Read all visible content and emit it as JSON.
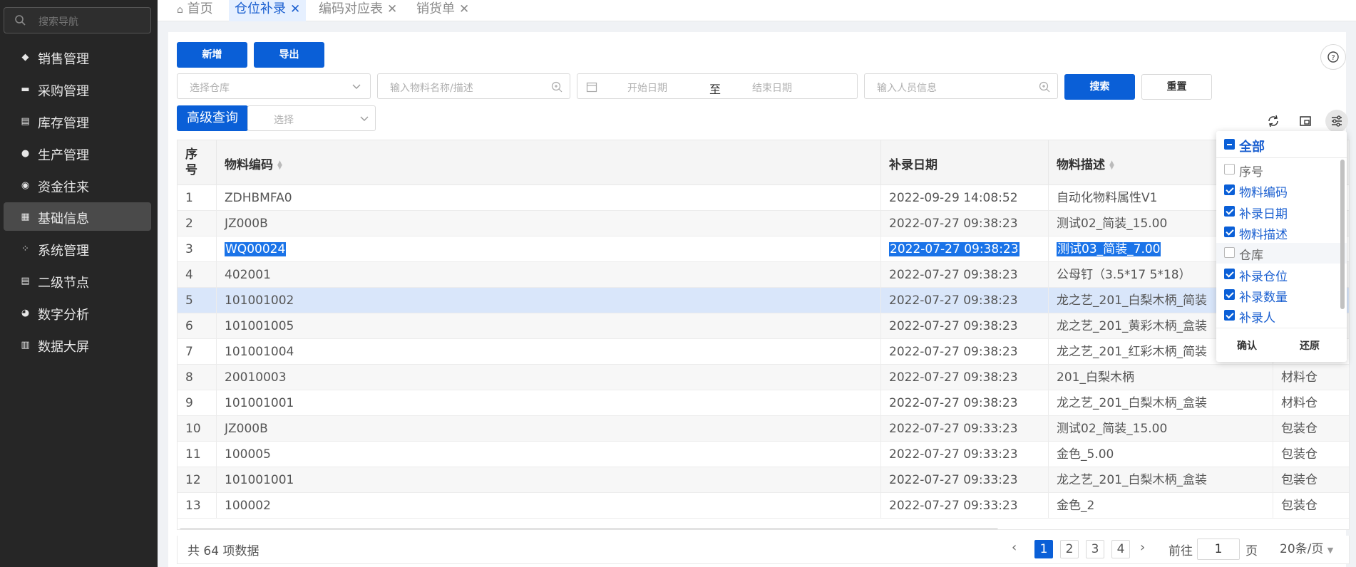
{
  "sidebar": {
    "search_placeholder": "搜索导航",
    "items": [
      {
        "label": "销售管理",
        "icon": "tag-icon"
      },
      {
        "label": "采购管理",
        "icon": "cart-icon"
      },
      {
        "label": "库存管理",
        "icon": "store-icon"
      },
      {
        "label": "生产管理",
        "icon": "cluster-icon"
      },
      {
        "label": "资金往来",
        "icon": "money-icon"
      },
      {
        "label": "基础信息",
        "icon": "grid-icon",
        "active": true
      },
      {
        "label": "系统管理",
        "icon": "apps-icon"
      },
      {
        "label": "二级节点",
        "icon": "list-icon"
      },
      {
        "label": "数字分析",
        "icon": "pie-icon"
      },
      {
        "label": "数据大屏",
        "icon": "report-icon"
      }
    ]
  },
  "tabs": [
    {
      "label": "首页"
    },
    {
      "label": "仓位补录"
    },
    {
      "label": "编码对应表"
    },
    {
      "label": "销货单"
    }
  ],
  "toolbar": {
    "add_label": "新增",
    "export_label": "导出"
  },
  "filters": {
    "warehouse_placeholder": "选择仓库",
    "material_placeholder": "输入物料名称/描述",
    "start_date_placeholder": "开始日期",
    "date_separator": "至",
    "end_date_placeholder": "结束日期",
    "person_placeholder": "输入人员信息",
    "search_label": "搜索",
    "reset_label": "重置",
    "advanced_label": "高级查询",
    "advanced_select_placeholder": "选择"
  },
  "table": {
    "headers": {
      "index": "序号",
      "material_code": "物料编码",
      "date": "补录日期",
      "description": "物料描述"
    },
    "rows": [
      {
        "index": "1",
        "code": "ZDHBMFA0",
        "date": "2022-09-29 14:08:52",
        "desc": "自动化物料属性V1",
        "wh": ""
      },
      {
        "index": "2",
        "code": "JZ000B",
        "date": "2022-07-27 09:38:23",
        "desc": "测试02_简装_15.00",
        "wh": ""
      },
      {
        "index": "3",
        "code": "WQ00024",
        "date": "2022-07-27 09:38:23",
        "desc": "测试03_简装_7.00",
        "wh": ""
      },
      {
        "index": "4",
        "code": "402001",
        "date": "2022-07-27 09:38:23",
        "desc": "公母钉（3.5*17 5*18）",
        "wh": ""
      },
      {
        "index": "5",
        "code": "101001002",
        "date": "2022-07-27 09:38:23",
        "desc": "龙之艺_201_白梨木柄_简装",
        "wh": ""
      },
      {
        "index": "6",
        "code": "101001005",
        "date": "2022-07-27 09:38:23",
        "desc": "龙之艺_201_黄彩木柄_盒装",
        "wh": ""
      },
      {
        "index": "7",
        "code": "101001004",
        "date": "2022-07-27 09:38:23",
        "desc": "龙之艺_201_红彩木柄_简装",
        "wh": ""
      },
      {
        "index": "8",
        "code": "20010003",
        "date": "2022-07-27 09:38:23",
        "desc": "201_白梨木柄",
        "wh": "材料仓"
      },
      {
        "index": "9",
        "code": "101001001",
        "date": "2022-07-27 09:38:23",
        "desc": "龙之艺_201_白梨木柄_盒装",
        "wh": "材料仓"
      },
      {
        "index": "10",
        "code": "JZ000B",
        "date": "2022-07-27 09:33:23",
        "desc": "测试02_简装_15.00",
        "wh": "包装仓"
      },
      {
        "index": "11",
        "code": "100005",
        "date": "2022-07-27 09:33:23",
        "desc": "金色_5.00",
        "wh": "包装仓"
      },
      {
        "index": "12",
        "code": "101001001",
        "date": "2022-07-27 09:33:23",
        "desc": "龙之艺_201_白梨木柄_盒装",
        "wh": "包装仓"
      },
      {
        "index": "13",
        "code": "100002",
        "date": "2022-07-27 09:33:23",
        "desc": "金色_2",
        "wh": "包装仓"
      }
    ]
  },
  "pagination": {
    "total_text": "共 64 项数据",
    "pages": [
      "1",
      "2",
      "3",
      "4"
    ],
    "current": "1",
    "goto_label": "前往",
    "goto_value": "1",
    "page_suffix": "页",
    "page_size": "20条/页"
  },
  "column_picker": {
    "all_label": "全部",
    "columns": [
      {
        "label": "序号",
        "checked": false
      },
      {
        "label": "物料编码",
        "checked": true
      },
      {
        "label": "补录日期",
        "checked": true
      },
      {
        "label": "物料描述",
        "checked": true
      },
      {
        "label": "仓库",
        "checked": false
      },
      {
        "label": "补录仓位",
        "checked": true
      },
      {
        "label": "补录数量",
        "checked": true
      },
      {
        "label": "补录人",
        "checked": true
      }
    ],
    "confirm_label": "确认",
    "restore_label": "还原"
  }
}
